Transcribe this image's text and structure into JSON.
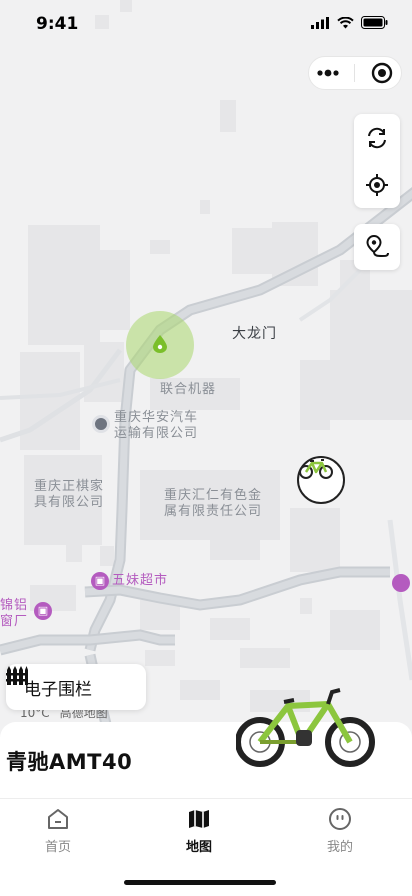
{
  "status_bar": {
    "time": "9:41"
  },
  "map": {
    "labels": {
      "dalongmen": "大龙门",
      "lianhe": "联合机器",
      "huaan_line1": "重庆华安汽车",
      "huaan_line2": "运输有限公司",
      "zhengqi_line1": "重庆正棋家",
      "zhengqi_line2": "具有限公司",
      "huiren_line1": "重庆汇仁有色金",
      "huiren_line2": "属有限责任公司",
      "wumei": "五妹超市",
      "jinlv_line1": "锦铝",
      "jinlv_line2": "窗厂",
      "jiu": "机"
    },
    "footer_temp": "10°C",
    "footer_provider": "高德地图",
    "fence_button": "电子围栏"
  },
  "vehicle": {
    "name": "青驰AMT40"
  },
  "tabs": [
    {
      "label": "首页",
      "icon": "home-icon"
    },
    {
      "label": "地图",
      "icon": "map-icon"
    },
    {
      "label": "我的",
      "icon": "profile-icon"
    }
  ],
  "colors": {
    "accent": "#8cc63e",
    "location": "#7bbf2a",
    "poi": "#b45bbf"
  }
}
